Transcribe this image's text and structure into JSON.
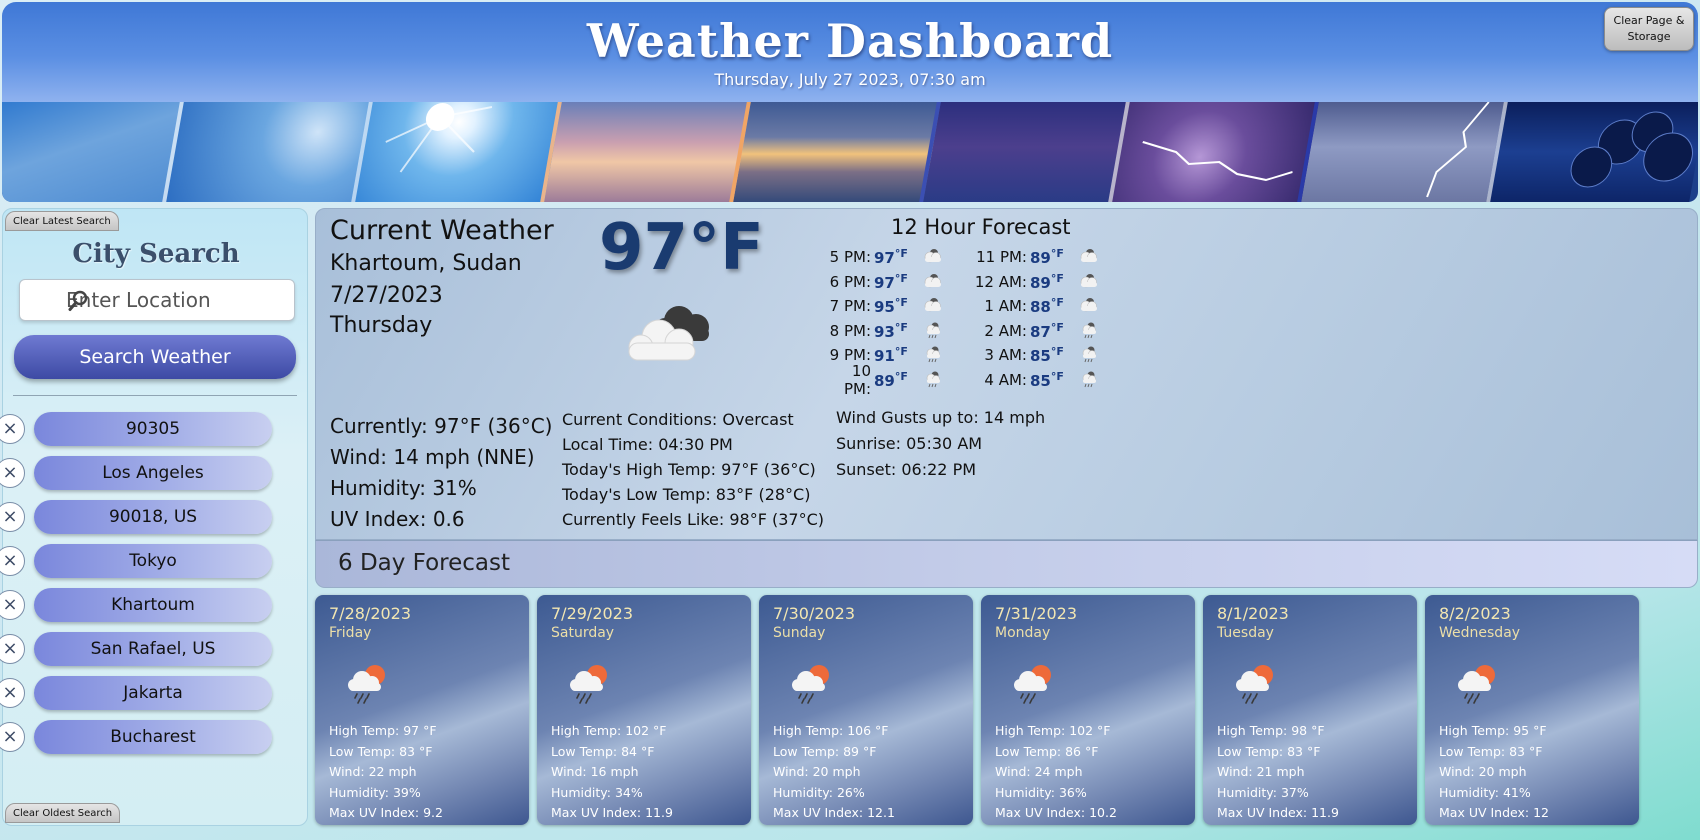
{
  "header": {
    "title": "Weather Dashboard",
    "datetime": "Thursday, July 27 2023, 07:30 am",
    "clear_btn_line1": "Clear Page &",
    "clear_btn_line2": "Storage"
  },
  "sidebar": {
    "clear_latest_label": "Clear Latest Search",
    "clear_oldest_label": "Clear Oldest Search",
    "title": "City Search",
    "search_placeholder": "Enter Location",
    "search_button_label": "Search Weather",
    "remove_symbol": "×",
    "history": [
      "90305",
      "Los Angeles",
      "90018, US",
      "Tokyo",
      "Khartoum",
      "San Rafael, US",
      "Jakarta",
      "Bucharest"
    ]
  },
  "current": {
    "title": "Current Weather",
    "city": "Khartoum, Sudan",
    "date": "7/27/2023",
    "day": "Thursday",
    "big_temp": "97°F",
    "icon": "overcast-clouds-icon",
    "currently": "Currently: 97°F (36°C)",
    "wind": "Wind: 14 mph (NNE)",
    "humidity": "Humidity: 31%",
    "uv": "UV Index: 0.6",
    "conditions": "Current Conditions: Overcast",
    "local_time": "Local Time: 04:30 PM",
    "high": "Today's High Temp: 97°F (36°C)",
    "low": "Today's Low Temp: 83°F (28°C)",
    "feels": "Currently Feels Like: 98°F (37°C)",
    "gusts": "Wind Gusts up to: 14 mph",
    "sunrise": "Sunrise: 05:30 AM",
    "sunset": "Sunset: 06:22 PM"
  },
  "hourly": {
    "title": "12 Hour Forecast",
    "col1": [
      {
        "time": "5 PM:",
        "temp": "97",
        "unit": "°F",
        "icon": "cloud-night-icon"
      },
      {
        "time": "6 PM:",
        "temp": "97",
        "unit": "°F",
        "icon": "cloud-night-icon"
      },
      {
        "time": "7 PM:",
        "temp": "95",
        "unit": "°F",
        "icon": "cloud-night-icon"
      },
      {
        "time": "8 PM:",
        "temp": "93",
        "unit": "°F",
        "icon": "rain-night-icon"
      },
      {
        "time": "9 PM:",
        "temp": "91",
        "unit": "°F",
        "icon": "rain-night-icon"
      },
      {
        "time": "10 PM:",
        "temp": "89",
        "unit": "°F",
        "icon": "rain-night-icon"
      }
    ],
    "col2": [
      {
        "time": "11 PM:",
        "temp": "89",
        "unit": "°F",
        "icon": "cloud-night-icon"
      },
      {
        "time": "12 AM:",
        "temp": "89",
        "unit": "°F",
        "icon": "cloud-night-icon"
      },
      {
        "time": "1 AM:",
        "temp": "88",
        "unit": "°F",
        "icon": "cloud-night-icon"
      },
      {
        "time": "2 AM:",
        "temp": "87",
        "unit": "°F",
        "icon": "rain-night-icon"
      },
      {
        "time": "3 AM:",
        "temp": "85",
        "unit": "°F",
        "icon": "rain-night-icon"
      },
      {
        "time": "4 AM:",
        "temp": "85",
        "unit": "°F",
        "icon": "rain-night-icon"
      }
    ]
  },
  "forecast": {
    "title": "6 Day Forecast",
    "days": [
      {
        "date": "7/28/2023",
        "day": "Friday",
        "high": "High Temp: 97 °F",
        "low": "Low Temp: 83 °F",
        "wind": "Wind: 22 mph",
        "humidity": "Humidity: 39%",
        "uv": "Max UV Index: 9.2",
        "icon": "sun-rain-cloud-icon"
      },
      {
        "date": "7/29/2023",
        "day": "Saturday",
        "high": "High Temp: 102 °F",
        "low": "Low Temp: 84 °F",
        "wind": "Wind: 16 mph",
        "humidity": "Humidity: 34%",
        "uv": "Max UV Index: 11.9",
        "icon": "sun-rain-cloud-icon"
      },
      {
        "date": "7/30/2023",
        "day": "Sunday",
        "high": "High Temp: 106 °F",
        "low": "Low Temp: 89 °F",
        "wind": "Wind: 20 mph",
        "humidity": "Humidity: 26%",
        "uv": "Max UV Index: 12.1",
        "icon": "sun-rain-cloud-icon"
      },
      {
        "date": "7/31/2023",
        "day": "Monday",
        "high": "High Temp: 102 °F",
        "low": "Low Temp: 86 °F",
        "wind": "Wind: 24 mph",
        "humidity": "Humidity: 36%",
        "uv": "Max UV Index: 10.2",
        "icon": "sun-rain-cloud-icon"
      },
      {
        "date": "8/1/2023",
        "day": "Tuesday",
        "high": "High Temp: 98 °F",
        "low": "Low Temp: 83 °F",
        "wind": "Wind: 21 mph",
        "humidity": "Humidity: 37%",
        "uv": "Max UV Index: 11.9",
        "icon": "sun-rain-cloud-icon"
      },
      {
        "date": "8/2/2023",
        "day": "Wednesday",
        "high": "High Temp: 95 °F",
        "low": "Low Temp: 83 °F",
        "wind": "Wind: 20 mph",
        "humidity": "Humidity: 41%",
        "uv": "Max UV Index: 12",
        "icon": "sun-rain-cloud-icon"
      }
    ]
  },
  "colors": {
    "header_blue": "#3f78d6",
    "search_button": "#3d4aa4",
    "temp_blue": "#1a3b80",
    "card_date": "#f3e7b2"
  }
}
